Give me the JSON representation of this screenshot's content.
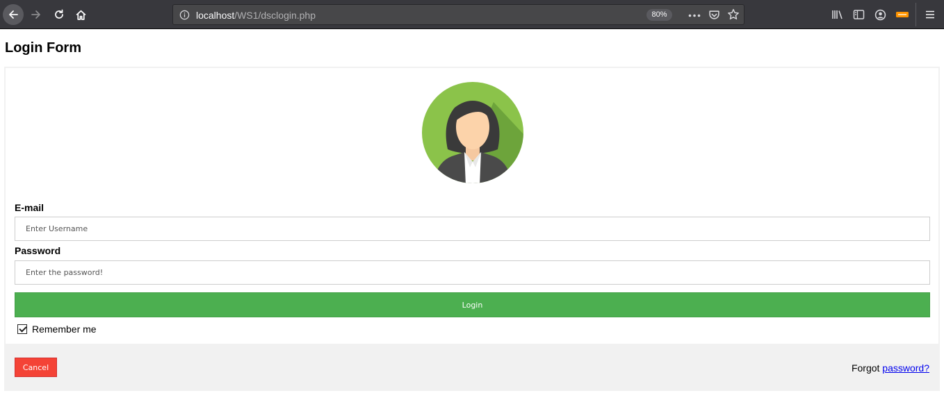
{
  "browser": {
    "url_host": "localhost",
    "url_path": "/WS1/dsclogin.php",
    "zoom": "80%"
  },
  "page": {
    "title": "Login Form"
  },
  "form": {
    "email_label": "E-mail",
    "email_placeholder": "Enter Username",
    "password_label": "Password",
    "password_placeholder": "Enter the password!",
    "login_label": "Login",
    "remember_label": "Remember me",
    "remember_checked": true,
    "cancel_label": "Cancel",
    "forgot_text": "Forgot",
    "forgot_link": "password?"
  },
  "colors": {
    "login_button": "#4caf50",
    "cancel_button": "#f44336",
    "avatar_background": "#8bc34a",
    "chrome_background": "#38383d"
  }
}
